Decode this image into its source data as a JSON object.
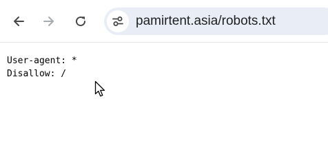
{
  "browser": {
    "url": "pamirtent.asia/robots.txt",
    "back_icon": "arrow-left-icon",
    "forward_icon": "arrow-right-icon",
    "reload_icon": "reload-icon",
    "site_info_icon": "tune-icon"
  },
  "page": {
    "lines": [
      "User-agent: *",
      "Disallow: /"
    ]
  },
  "colors": {
    "omnibox_bg": "#e9eef6",
    "icon_active": "#444746",
    "icon_disabled": "#a8abad"
  }
}
